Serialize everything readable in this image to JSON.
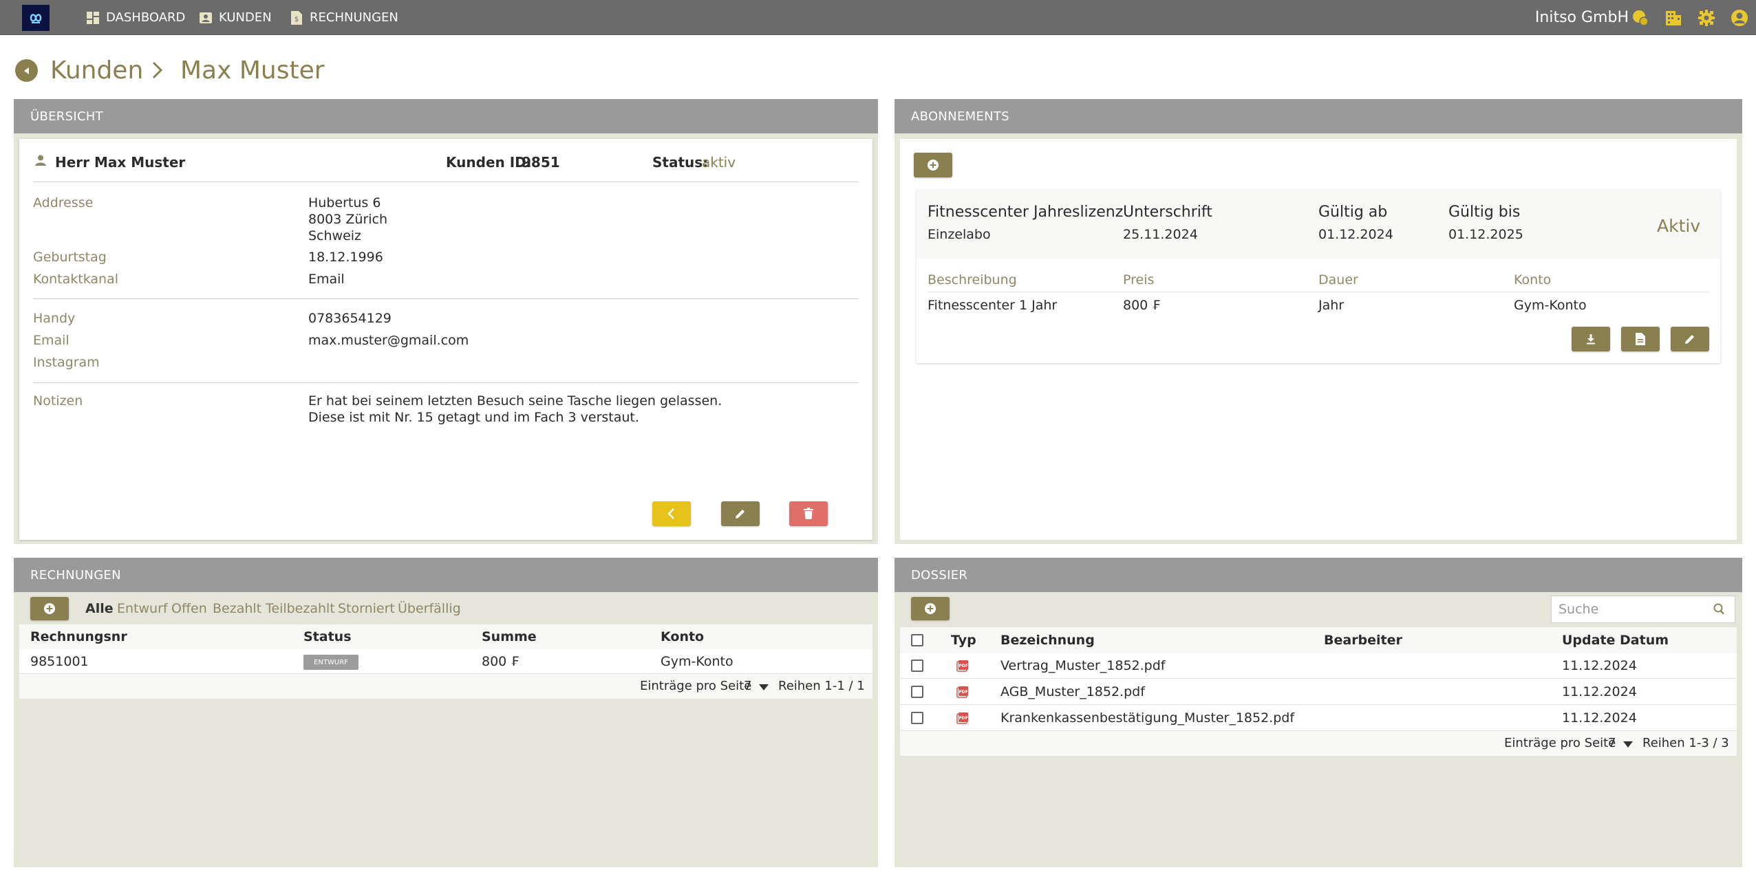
{
  "topbar": {
    "nav": [
      {
        "label": "DASHBOARD",
        "icon": "dashboard-icon"
      },
      {
        "label": "KUNDEN",
        "icon": "contact-card-icon"
      },
      {
        "label": "RECHNUNGEN",
        "icon": "invoice-icon"
      }
    ],
    "company": "Initso GmbH",
    "icons": [
      "coins-icon",
      "building-icon",
      "gear-icon",
      "user-circle-icon"
    ]
  },
  "breadcrumb": {
    "parent": "Kunden",
    "current": "Max Muster"
  },
  "overview": {
    "header": "ÜBERSICHT",
    "name": "Herr Max Muster",
    "customer_id_label": "Kunden ID:",
    "customer_id": "9851",
    "status_label": "Status:",
    "status": "aktiv",
    "fields": {
      "address_label": "Addresse",
      "address_line1": "Hubertus 6",
      "address_line2": "8003 Zürich",
      "address_line3": "Schweiz",
      "birthday_label": "Geburtstag",
      "birthday": "18.12.1996",
      "channel_label": "Kontaktkanal",
      "channel": "Email",
      "mobile_label": "Handy",
      "mobile": "0783654129",
      "email_label": "Email",
      "email": "max.muster@gmail.com",
      "instagram_label": "Instagram",
      "instagram": "",
      "notes_label": "Notizen",
      "notes_line1": "Er hat bei seinem letzten Besuch seine Tasche liegen gelassen.",
      "notes_line2": "Diese ist mit Nr. 15 getagt und im Fach 3 verstaut."
    }
  },
  "subscriptions": {
    "header": "ABONNEMENTS",
    "item": {
      "title": "Fitnesscenter Jahreslizenz",
      "subtitle": "Einzelabo",
      "signature_label": "Unterschrift",
      "signature_date": "25.11.2024",
      "valid_from_label": "Gültig ab",
      "valid_from": "01.12.2024",
      "valid_to_label": "Gültig bis",
      "valid_to": "01.12.2025",
      "state": "Aktiv",
      "desc_label": "Beschreibung",
      "desc": "Fitnesscenter 1 Jahr",
      "price_label": "Preis",
      "price": "800 ₣",
      "duration_label": "Dauer",
      "duration": "Jahr",
      "account_label": "Konto",
      "account": "Gym-Konto"
    }
  },
  "invoices": {
    "header": "RECHNUNGEN",
    "filters": [
      "Alle",
      "Entwurf",
      "Offen",
      "Bezahlt",
      "Teilbezahlt",
      "Storniert",
      "Überfällig"
    ],
    "columns": [
      "Rechnungsnr",
      "Status",
      "Summe",
      "Konto"
    ],
    "rows": [
      {
        "number": "9851001",
        "status": "ENTWURF",
        "sum": "800 ₣",
        "account": "Gym-Konto"
      }
    ],
    "per_page_label": "Einträge pro Seite",
    "per_page": "7",
    "range": "Reihen 1-1 / 1"
  },
  "dossier": {
    "header": "DOSSIER",
    "search_placeholder": "Suche",
    "columns": [
      "Typ",
      "Bezeichnung",
      "Bearbeiter",
      "Update Datum"
    ],
    "rows": [
      {
        "name": "Vertrag_Muster_1852.pdf",
        "editor": "",
        "date": "11.12.2024"
      },
      {
        "name": "AGB_Muster_1852.pdf",
        "editor": "",
        "date": "11.12.2024"
      },
      {
        "name": "Krankenkassenbestätigung_Muster_1852.pdf",
        "editor": "",
        "date": "11.12.2024"
      }
    ],
    "per_page_label": "Einträge pro Seite",
    "per_page": "7",
    "range": "Reihen 1-3 / 3"
  },
  "colors": {
    "accent": "#8a804f",
    "topbar": "#6b6b6b",
    "panel_header": "#9a9a9a",
    "panel_bg": "#e6e5da",
    "yellow": "#e6c21a",
    "red": "#e06f6a",
    "pdf_red": "#d9534f"
  }
}
